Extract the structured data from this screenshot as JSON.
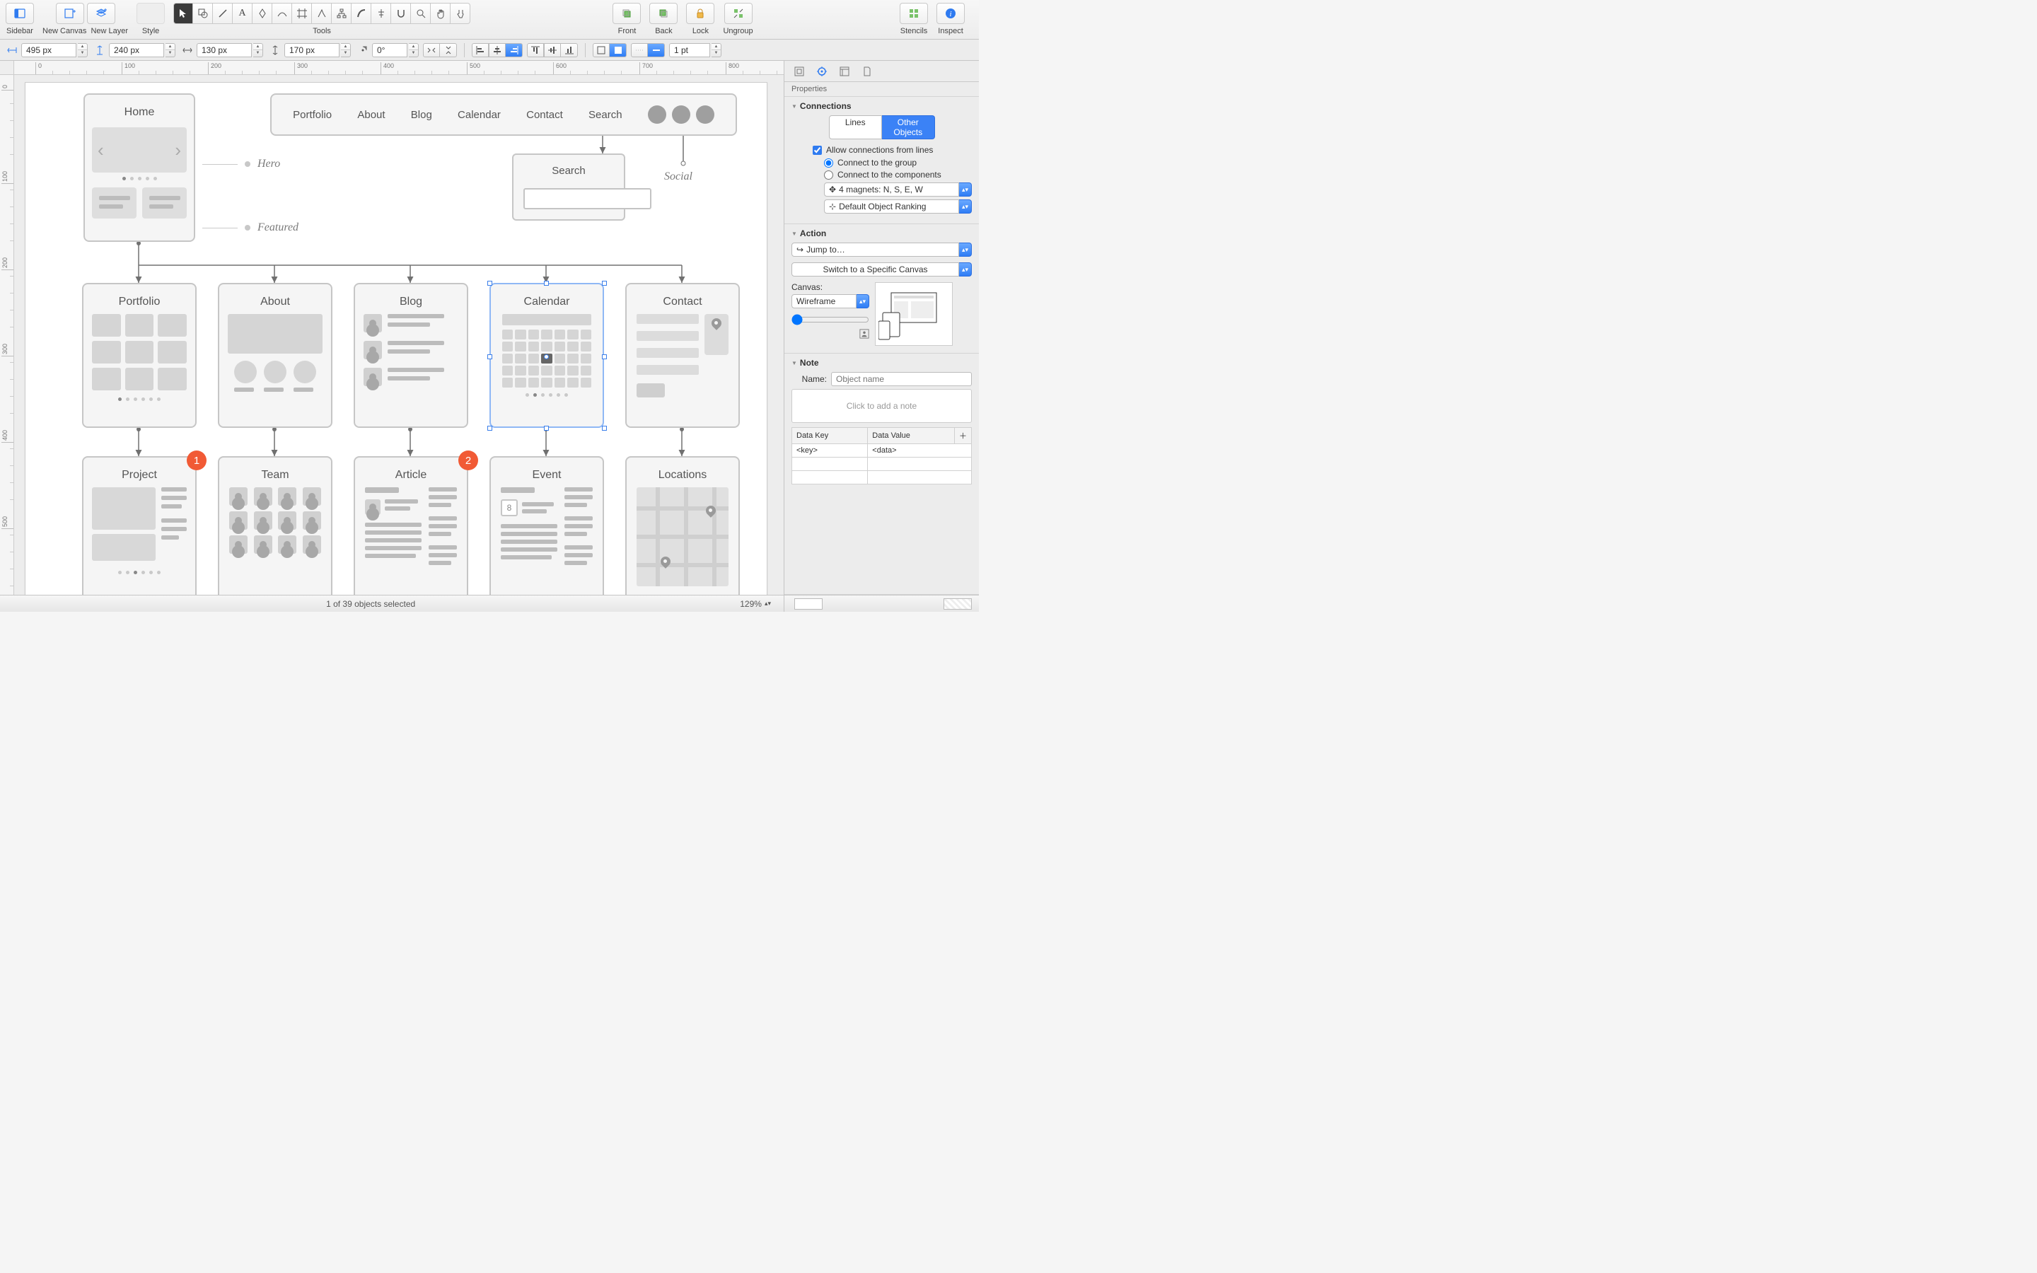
{
  "toolbar": {
    "sidebar": "Sidebar",
    "new_canvas": "New Canvas",
    "new_layer": "New Layer",
    "style": "Style",
    "tools": "Tools",
    "front": "Front",
    "back": "Back",
    "lock": "Lock",
    "ungroup": "Ungroup",
    "stencils": "Stencils",
    "inspect": "Inspect"
  },
  "subtoolbar": {
    "x": "495 px",
    "y": "240 px",
    "w": "130 px",
    "h": "170 px",
    "rot": "0°",
    "stroke": "1 pt"
  },
  "ruler_h": [
    "0",
    "100",
    "200",
    "300",
    "400",
    "500",
    "600",
    "700",
    "800"
  ],
  "ruler_v": [
    "0",
    "100",
    "200",
    "300",
    "400",
    "500"
  ],
  "canvas": {
    "home": "Home",
    "nav": [
      "Portfolio",
      "About",
      "Blog",
      "Calendar",
      "Contact",
      "Search"
    ],
    "annot_hero": "Hero",
    "annot_featured": "Featured",
    "annot_social": "Social",
    "search_title": "Search",
    "row2": [
      "Portfolio",
      "About",
      "Blog",
      "Calendar",
      "Contact"
    ],
    "row3": [
      "Project",
      "Team",
      "Article",
      "Event",
      "Locations"
    ],
    "badge1": "1",
    "badge2": "2",
    "event_day": "8"
  },
  "inspector": {
    "header": "Properties",
    "connections": {
      "title": "Connections",
      "tab_lines": "Lines",
      "tab_other": "Other Objects",
      "allow": "Allow connections from lines",
      "r1": "Connect to the group",
      "r2": "Connect to the components",
      "magnets": "4 magnets: N, S, E, W",
      "ranking": "Default Object Ranking"
    },
    "action": {
      "title": "Action",
      "jumpto": "Jump to…",
      "switch": "Switch to a Specific Canvas",
      "canvas_lbl": "Canvas:",
      "canvas_val": "Wireframe"
    },
    "note": {
      "title": "Note",
      "name_lbl": "Name:",
      "name_ph": "Object name",
      "placeholder": "Click to add a note",
      "key_h": "Data Key",
      "val_h": "Data Value",
      "key": "<key>",
      "val": "<data>"
    }
  },
  "status": {
    "selection": "1 of 39 objects selected",
    "zoom": "129%"
  }
}
